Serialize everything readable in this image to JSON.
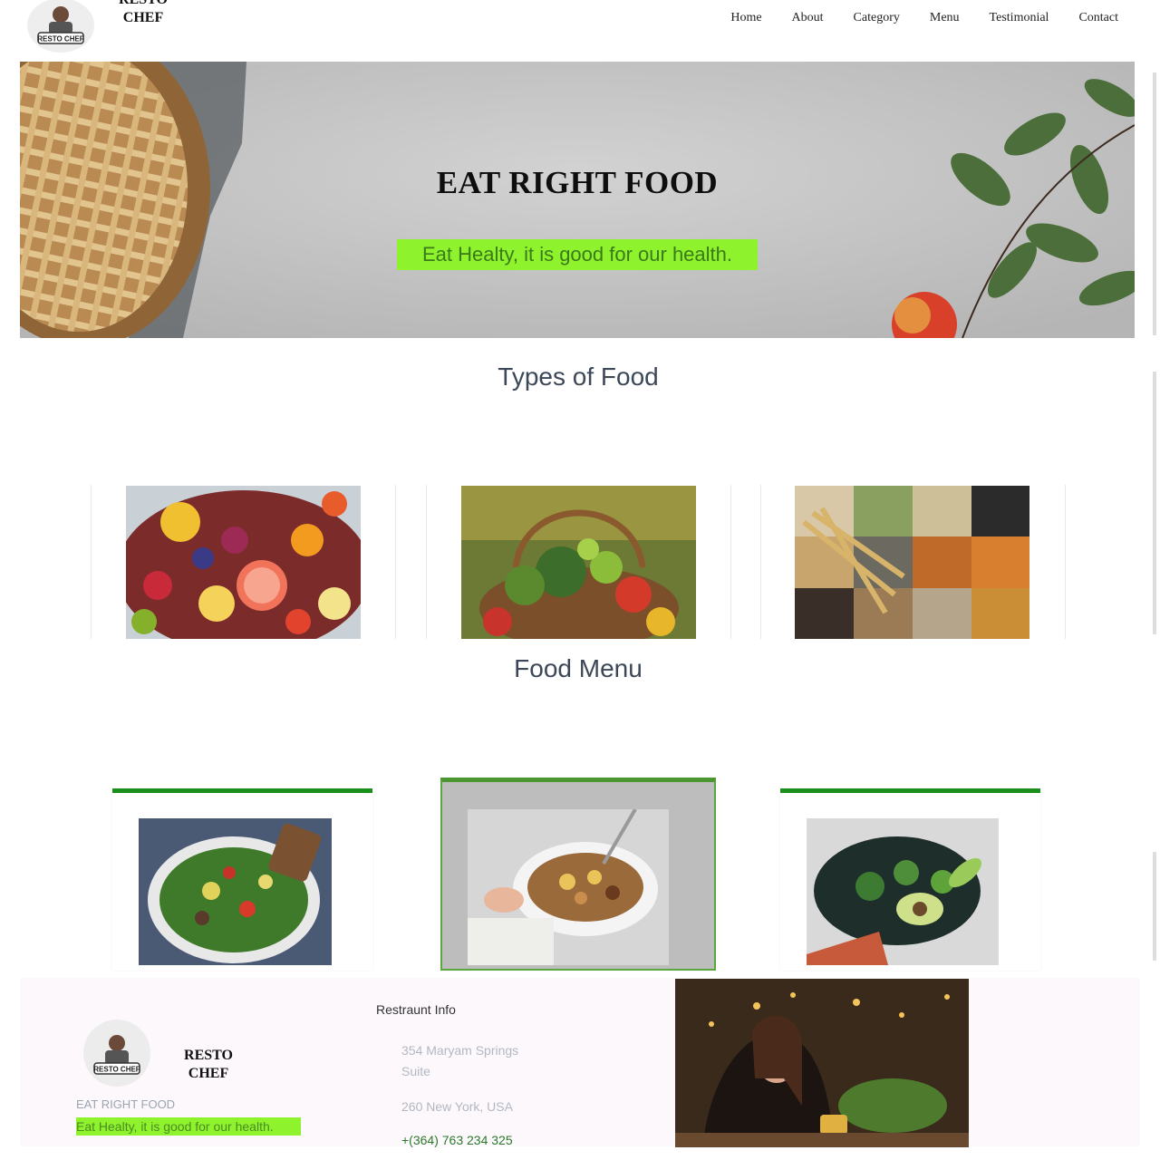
{
  "header": {
    "brand_top": "RESTO",
    "brand_bottom": "CHEF",
    "logo_text": "RESTO CHEF",
    "nav": [
      "Home",
      "About",
      "Category",
      "Menu",
      "Testimonial",
      "Contact"
    ]
  },
  "hero": {
    "title": "EAT RIGHT FOOD",
    "subtitle": "Eat Healty, it is good for our health."
  },
  "types": {
    "title": "Types of Food",
    "items": [
      "fruits-image",
      "vegetables-basket-image",
      "grains-seeds-image"
    ]
  },
  "menu": {
    "title": "Food Menu",
    "items": [
      "salad-bowl-image",
      "oatmeal-bowl-image",
      "avocado-greens-image"
    ]
  },
  "footer": {
    "brand_top": "RESTO",
    "brand_bottom": "CHEF",
    "logo_text": "RESTO CHEF",
    "tagline": "EAT RIGHT FOOD",
    "highlight": "Eat Healty, it is good for our health.",
    "info_title": "Restraunt Info",
    "address_line1": "354 Maryam Springs",
    "address_line2": "Suite",
    "city": "260 New York, USA",
    "phone": "+(364) 763 234 325"
  },
  "colors": {
    "accent_green": "#8ef22d",
    "card_border": "#1b8f1b",
    "heading": "#3c4858"
  }
}
